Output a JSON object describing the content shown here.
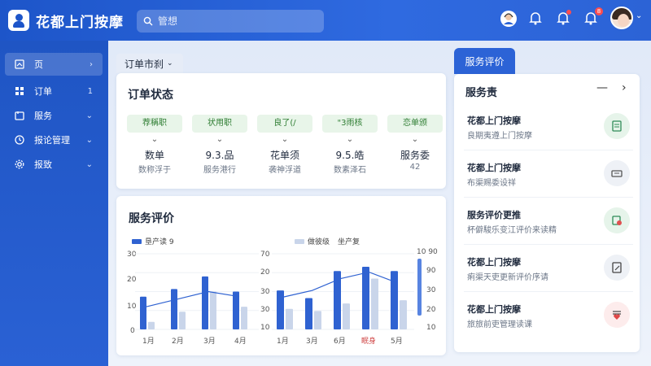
{
  "app": {
    "title": "花都上门按摩"
  },
  "search": {
    "placeholder": "管想"
  },
  "header": {
    "notification_badge": "8"
  },
  "sidebar": {
    "items": [
      {
        "label": "页",
        "trail": "›"
      },
      {
        "label": "订单",
        "trail": "1"
      },
      {
        "label": "服务",
        "trail": "⌄"
      },
      {
        "label": "报论管理",
        "trail": "⌄"
      },
      {
        "label": "报致",
        "trail": "⌄"
      }
    ]
  },
  "order_tab": {
    "label": "订单市刹"
  },
  "order_status": {
    "title": "订单状态",
    "items": [
      {
        "pill": "荐稱职",
        "value": "数单",
        "sub": "数称浮于"
      },
      {
        "pill": "状用职",
        "value": "9.3.品",
        "sub": "服务港行"
      },
      {
        "pill": "良了(/",
        "value": "花单须",
        "sub": "袭神浮道"
      },
      {
        "pill": "\"3雨核",
        "value": "9.5.皓",
        "sub": "数素泽石"
      },
      {
        "pill": "恋单颁",
        "value": "服务委",
        "sub": "42"
      }
    ]
  },
  "service_review": {
    "title": "服务评价",
    "legend_left": "垦产读 9",
    "legend_right_a": "做彼级",
    "legend_right_b": "坐产复",
    "left_y_ticks": [
      "30",
      "20",
      "10",
      "0"
    ],
    "right_y_left_ticks": [
      "70",
      "20",
      "30",
      "30",
      "10"
    ],
    "right_y_right_ticks": [
      "10 90",
      "90",
      "30",
      "20",
      "10"
    ],
    "left_x": [
      "1月",
      "2月",
      "3月",
      "4月"
    ],
    "right_x": [
      "1月",
      "3月",
      "6月",
      "眠身",
      "5月"
    ]
  },
  "chart_data": [
    {
      "type": "bar",
      "categories": [
        "1月",
        "2月",
        "3月",
        "4月"
      ],
      "series": [
        {
          "name": "垦产读 9",
          "values": [
            13,
            16,
            21,
            15
          ]
        },
        {
          "values": [
            3,
            7,
            15,
            9
          ]
        }
      ],
      "line": [
        9,
        12,
        15,
        13
      ],
      "ylim": [
        0,
        30
      ]
    },
    {
      "type": "bar",
      "categories": [
        "1月",
        "3月",
        "6月",
        "眠身",
        "5月"
      ],
      "series": [
        {
          "name": "做彼级",
          "values": [
            36,
            29,
            54,
            58,
            54
          ]
        },
        {
          "name": "坐产复",
          "values": [
            19,
            17,
            24,
            47,
            27
          ]
        }
      ],
      "line": [
        30,
        36,
        47,
        53,
        43
      ],
      "ylim": [
        0,
        70
      ]
    }
  ],
  "right_panel": {
    "tab": "服务评价",
    "header": "服务责",
    "items": [
      {
        "title": "花都上门按摩",
        "sub": "良期夷遵上门按摩"
      },
      {
        "title": "花都上门按摩",
        "sub": "布渠赐委设祥"
      },
      {
        "title": "服务评价更推",
        "sub": "杯僻駿乐变江评价来读精"
      },
      {
        "title": "花都上门按摩",
        "sub": "痢渠天吏更新评价序请"
      },
      {
        "title": "花都上门按摩",
        "sub": "旅旅前吏管理读课"
      }
    ]
  },
  "colors": {
    "primary": "#2c63d6",
    "accent_green": "#2e7d32",
    "bar_dark": "#2f62d1",
    "bar_light": "#c9d5ea"
  }
}
